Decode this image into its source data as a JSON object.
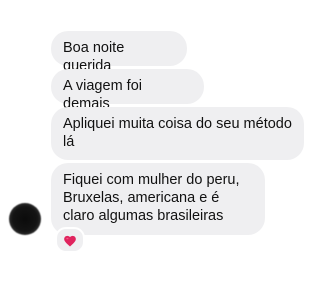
{
  "messages": [
    {
      "text": "Boa noite querida"
    },
    {
      "text": "A viagem foi demais"
    },
    {
      "text": "Apliquei muita coisa do seu método lá"
    },
    {
      "text": "Fiquei com mulher do peru, Bruxelas, americana e é claro algumas brasileiras"
    }
  ],
  "reaction": {
    "icon": "red-heart-icon",
    "color": "#e0245e"
  },
  "colors": {
    "bubble": "#efeff1",
    "text": "#111111",
    "background": "#ffffff"
  }
}
